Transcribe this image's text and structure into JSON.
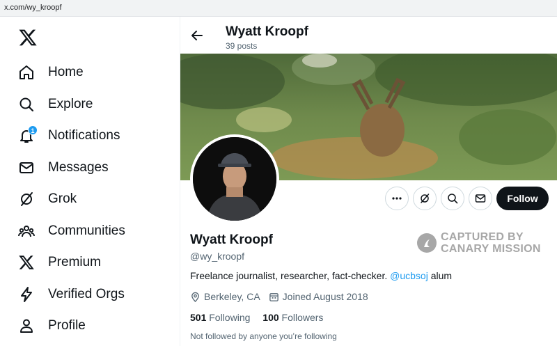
{
  "browser": {
    "url": "x.com/wy_kroopf"
  },
  "sidebar": {
    "items": [
      {
        "label": "Home",
        "icon": "home-icon"
      },
      {
        "label": "Explore",
        "icon": "search-icon"
      },
      {
        "label": "Notifications",
        "icon": "bell-icon",
        "badge": "1"
      },
      {
        "label": "Messages",
        "icon": "envelope-icon"
      },
      {
        "label": "Grok",
        "icon": "grok-icon"
      },
      {
        "label": "Communities",
        "icon": "people-icon"
      },
      {
        "label": "Premium",
        "icon": "x-logo-icon"
      },
      {
        "label": "Verified Orgs",
        "icon": "lightning-icon"
      },
      {
        "label": "Profile",
        "icon": "person-icon"
      }
    ]
  },
  "header": {
    "name": "Wyatt Kroopf",
    "posts": "39 posts"
  },
  "profile": {
    "name": "Wyatt Kroopf",
    "handle": "@wy_kroopf",
    "bio_text": "Freelance journalist, researcher, fact-checker.",
    "bio_mention": "@ucbsoj",
    "bio_suffix": "alum",
    "location": "Berkeley, CA",
    "joined": "Joined August 2018",
    "following_count": "501",
    "following_label": "Following",
    "followers_count": "100",
    "followers_label": "Followers",
    "not_followed": "Not followed by anyone you’re following",
    "follow_label": "Follow"
  },
  "watermark": {
    "line1": "CAPTURED BY",
    "line2": "CANARY MISSION"
  },
  "colors": {
    "accent": "#1d9bf0",
    "text": "#0f1419",
    "muted": "#536471"
  }
}
